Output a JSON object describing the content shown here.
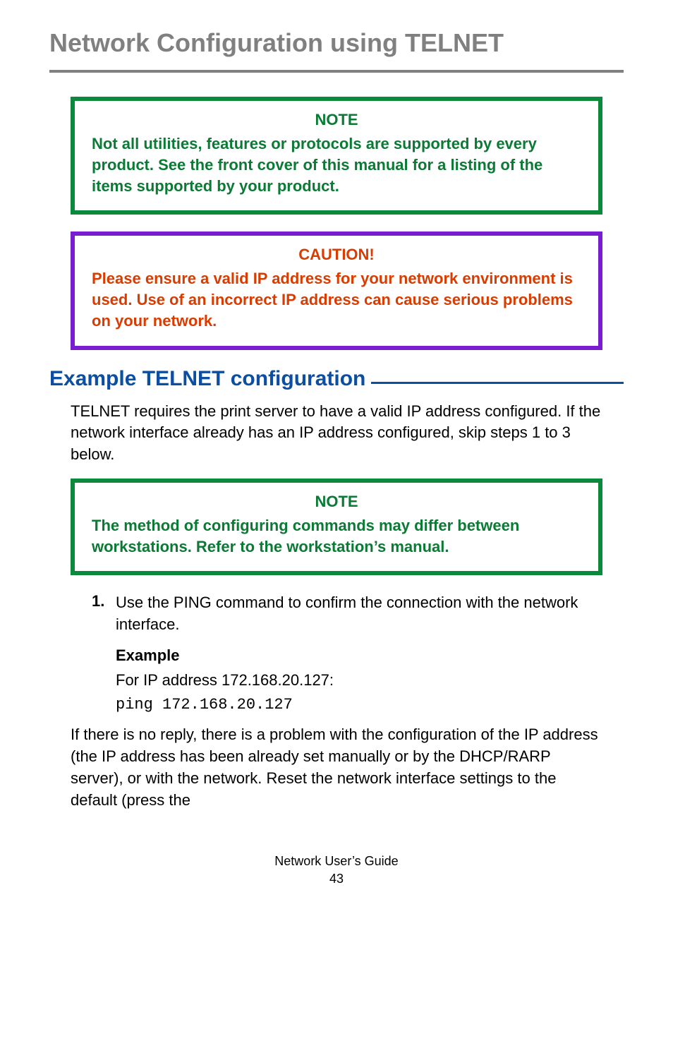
{
  "heading": "Network Configuration using  TELNET",
  "note1": {
    "title": "NOTE",
    "body": "Not all utilities, features or protocols are supported by every product. See the front cover of this manual for a listing of the items supported by your product."
  },
  "caution": {
    "title": "CAUTION!",
    "body": "Please ensure a valid IP address for your network environment is used. Use of an incorrect IP address can cause serious problems on your network."
  },
  "section_heading": "Example TELNET configuration",
  "intro_para": "TELNET requires the print server to have a valid IP address configured. If the network interface already has an IP address configured, skip steps 1 to 3 below.",
  "note2": {
    "title": "NOTE",
    "body": "The method of configuring commands may differ between workstations. Refer to the workstation’s manual."
  },
  "step1": {
    "num": "1.",
    "text": "Use the PING command to confirm the connection with the network interface.",
    "example_label": "Example",
    "example_text": "For IP address 172.168.20.127:",
    "command": "ping 172.168.20.127"
  },
  "tail_para": "If there is no reply, there is a problem with the configuration of the IP address (the IP address has been already set manually or by the DHCP/RARP server), or with the network. Reset the network interface settings to the default (press the",
  "footer": {
    "title": "Network User’s Guide",
    "page": "43"
  }
}
